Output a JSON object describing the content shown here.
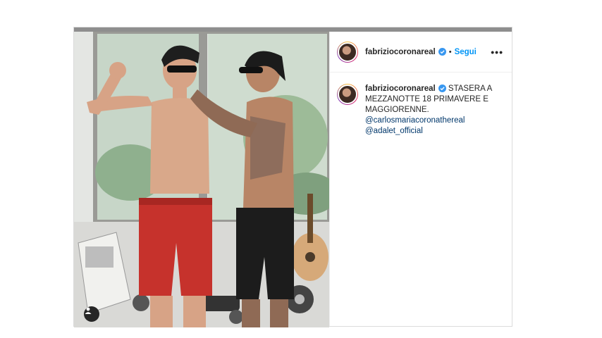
{
  "post": {
    "username": "fabriziocoronareal",
    "follow_label": "Segui",
    "more_label": "•••",
    "dot": "•",
    "caption": {
      "username": "fabriziocoronareal",
      "text": "STASERA A MEZZANOTTE 18 PRIMAVERE E MAGGIORENNE.",
      "mentions": [
        "@carlosmariacoronathereal",
        "@adalet_official"
      ]
    }
  },
  "colors": {
    "follow": "#0095f6",
    "verified": "#3897f0",
    "mention": "#00376b"
  },
  "icons": {
    "verified": "verified-badge-icon",
    "tag": "user-tag-icon",
    "more": "more-options-icon"
  }
}
